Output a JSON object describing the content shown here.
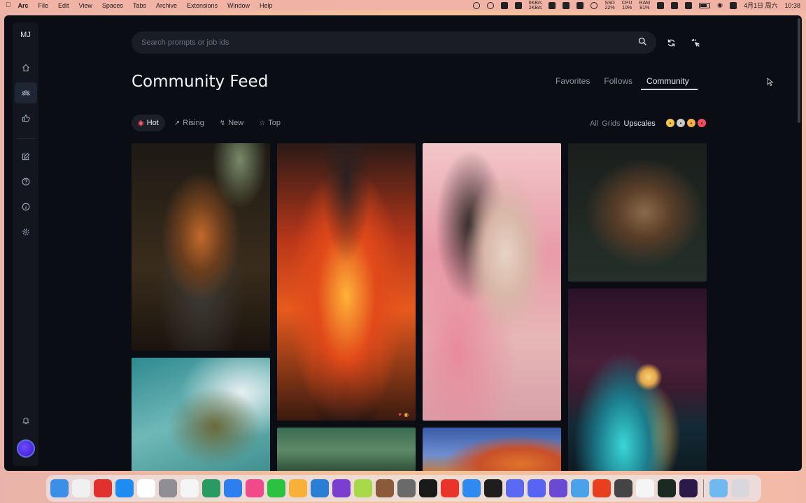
{
  "menubar": {
    "app": "Arc",
    "items": [
      "File",
      "Edit",
      "View",
      "Spaces",
      "Tabs",
      "Archive",
      "Extensions",
      "Window",
      "Help"
    ],
    "net_up": "0KB/s",
    "net_down": "2KB/s",
    "ssd_label": "SSD",
    "ssd_value": "22%",
    "cpu_label": "CPU",
    "cpu_value": "10%",
    "ram_label": "RAM",
    "ram_value": "81%",
    "date": "4月1日 周六",
    "time": "10:38"
  },
  "sidebar": {
    "logo": "MJ",
    "icons": [
      "home-icon",
      "community-icon",
      "thumbs-up-icon",
      "edit-icon",
      "help-icon",
      "info-icon",
      "settings-icon",
      "bell-icon"
    ]
  },
  "search": {
    "placeholder": "Search prompts or job ids"
  },
  "page": {
    "title": "Community Feed"
  },
  "feed_tabs": [
    {
      "label": "Favorites",
      "active": false
    },
    {
      "label": "Follows",
      "active": false
    },
    {
      "label": "Community",
      "active": true
    }
  ],
  "filters": [
    {
      "label": "Hot",
      "icon": "flame-icon",
      "active": true
    },
    {
      "label": "Rising",
      "icon": "trend-icon",
      "active": false
    },
    {
      "label": "New",
      "icon": "bolt-icon",
      "active": false
    },
    {
      "label": "Top",
      "icon": "star-icon",
      "active": false
    }
  ],
  "view_filters": [
    {
      "label": "All",
      "active": false
    },
    {
      "label": "Grids",
      "active": false
    },
    {
      "label": "Upscales",
      "active": true
    }
  ],
  "reaction_filters": [
    "grimace-emoji",
    "neutral-emoji",
    "smile-emoji",
    "heart-eyes-emoji"
  ],
  "gallery": [
    {
      "name": "fox-warrior-image",
      "subject": "fox warrior"
    },
    {
      "name": "teal-dragon-image",
      "subject": "dragon"
    },
    {
      "name": "fire-dragon-image",
      "subject": "fire dragon"
    },
    {
      "name": "forest-image",
      "subject": "forest"
    },
    {
      "name": "flower-woman-image",
      "subject": "woman with flowers"
    },
    {
      "name": "balloons-image",
      "subject": "hot air balloons"
    },
    {
      "name": "dog-portrait-image",
      "subject": "dog"
    },
    {
      "name": "moon-beach-image",
      "subject": "moonlit beach"
    }
  ],
  "colors": {
    "background": "#0b0d14",
    "sidebar": "#13161e",
    "accent_hot": "#ff5a6a"
  }
}
